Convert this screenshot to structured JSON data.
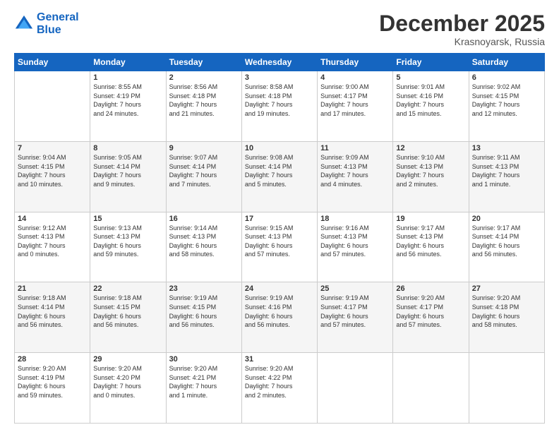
{
  "header": {
    "logo_line1": "General",
    "logo_line2": "Blue",
    "month": "December 2025",
    "location": "Krasnoyarsk, Russia"
  },
  "weekdays": [
    "Sunday",
    "Monday",
    "Tuesday",
    "Wednesday",
    "Thursday",
    "Friday",
    "Saturday"
  ],
  "weeks": [
    [
      {
        "day": "",
        "info": ""
      },
      {
        "day": "1",
        "info": "Sunrise: 8:55 AM\nSunset: 4:19 PM\nDaylight: 7 hours\nand 24 minutes."
      },
      {
        "day": "2",
        "info": "Sunrise: 8:56 AM\nSunset: 4:18 PM\nDaylight: 7 hours\nand 21 minutes."
      },
      {
        "day": "3",
        "info": "Sunrise: 8:58 AM\nSunset: 4:18 PM\nDaylight: 7 hours\nand 19 minutes."
      },
      {
        "day": "4",
        "info": "Sunrise: 9:00 AM\nSunset: 4:17 PM\nDaylight: 7 hours\nand 17 minutes."
      },
      {
        "day": "5",
        "info": "Sunrise: 9:01 AM\nSunset: 4:16 PM\nDaylight: 7 hours\nand 15 minutes."
      },
      {
        "day": "6",
        "info": "Sunrise: 9:02 AM\nSunset: 4:15 PM\nDaylight: 7 hours\nand 12 minutes."
      }
    ],
    [
      {
        "day": "7",
        "info": "Sunrise: 9:04 AM\nSunset: 4:15 PM\nDaylight: 7 hours\nand 10 minutes."
      },
      {
        "day": "8",
        "info": "Sunrise: 9:05 AM\nSunset: 4:14 PM\nDaylight: 7 hours\nand 9 minutes."
      },
      {
        "day": "9",
        "info": "Sunrise: 9:07 AM\nSunset: 4:14 PM\nDaylight: 7 hours\nand 7 minutes."
      },
      {
        "day": "10",
        "info": "Sunrise: 9:08 AM\nSunset: 4:14 PM\nDaylight: 7 hours\nand 5 minutes."
      },
      {
        "day": "11",
        "info": "Sunrise: 9:09 AM\nSunset: 4:13 PM\nDaylight: 7 hours\nand 4 minutes."
      },
      {
        "day": "12",
        "info": "Sunrise: 9:10 AM\nSunset: 4:13 PM\nDaylight: 7 hours\nand 2 minutes."
      },
      {
        "day": "13",
        "info": "Sunrise: 9:11 AM\nSunset: 4:13 PM\nDaylight: 7 hours\nand 1 minute."
      }
    ],
    [
      {
        "day": "14",
        "info": "Sunrise: 9:12 AM\nSunset: 4:13 PM\nDaylight: 7 hours\nand 0 minutes."
      },
      {
        "day": "15",
        "info": "Sunrise: 9:13 AM\nSunset: 4:13 PM\nDaylight: 6 hours\nand 59 minutes."
      },
      {
        "day": "16",
        "info": "Sunrise: 9:14 AM\nSunset: 4:13 PM\nDaylight: 6 hours\nand 58 minutes."
      },
      {
        "day": "17",
        "info": "Sunrise: 9:15 AM\nSunset: 4:13 PM\nDaylight: 6 hours\nand 57 minutes."
      },
      {
        "day": "18",
        "info": "Sunrise: 9:16 AM\nSunset: 4:13 PM\nDaylight: 6 hours\nand 57 minutes."
      },
      {
        "day": "19",
        "info": "Sunrise: 9:17 AM\nSunset: 4:13 PM\nDaylight: 6 hours\nand 56 minutes."
      },
      {
        "day": "20",
        "info": "Sunrise: 9:17 AM\nSunset: 4:14 PM\nDaylight: 6 hours\nand 56 minutes."
      }
    ],
    [
      {
        "day": "21",
        "info": "Sunrise: 9:18 AM\nSunset: 4:14 PM\nDaylight: 6 hours\nand 56 minutes."
      },
      {
        "day": "22",
        "info": "Sunrise: 9:18 AM\nSunset: 4:15 PM\nDaylight: 6 hours\nand 56 minutes."
      },
      {
        "day": "23",
        "info": "Sunrise: 9:19 AM\nSunset: 4:15 PM\nDaylight: 6 hours\nand 56 minutes."
      },
      {
        "day": "24",
        "info": "Sunrise: 9:19 AM\nSunset: 4:16 PM\nDaylight: 6 hours\nand 56 minutes."
      },
      {
        "day": "25",
        "info": "Sunrise: 9:19 AM\nSunset: 4:17 PM\nDaylight: 6 hours\nand 57 minutes."
      },
      {
        "day": "26",
        "info": "Sunrise: 9:20 AM\nSunset: 4:17 PM\nDaylight: 6 hours\nand 57 minutes."
      },
      {
        "day": "27",
        "info": "Sunrise: 9:20 AM\nSunset: 4:18 PM\nDaylight: 6 hours\nand 58 minutes."
      }
    ],
    [
      {
        "day": "28",
        "info": "Sunrise: 9:20 AM\nSunset: 4:19 PM\nDaylight: 6 hours\nand 59 minutes."
      },
      {
        "day": "29",
        "info": "Sunrise: 9:20 AM\nSunset: 4:20 PM\nDaylight: 7 hours\nand 0 minutes."
      },
      {
        "day": "30",
        "info": "Sunrise: 9:20 AM\nSunset: 4:21 PM\nDaylight: 7 hours\nand 1 minute."
      },
      {
        "day": "31",
        "info": "Sunrise: 9:20 AM\nSunset: 4:22 PM\nDaylight: 7 hours\nand 2 minutes."
      },
      {
        "day": "",
        "info": ""
      },
      {
        "day": "",
        "info": ""
      },
      {
        "day": "",
        "info": ""
      }
    ]
  ]
}
